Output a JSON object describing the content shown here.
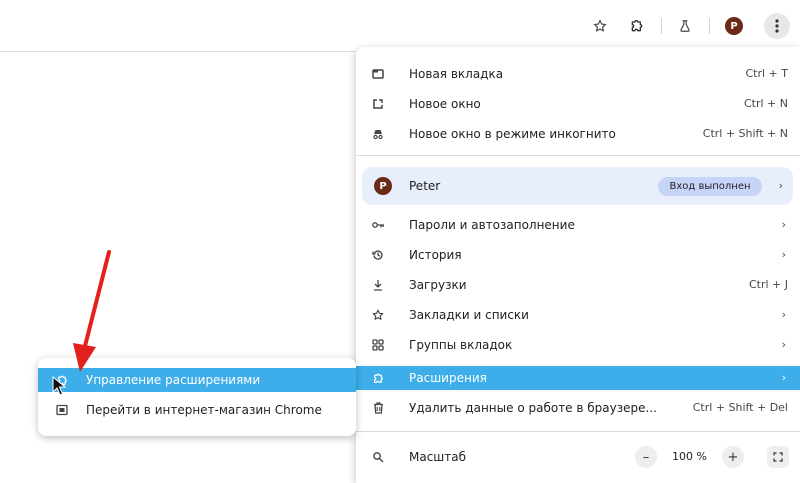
{
  "toolbar": {
    "icons": [
      "star-icon",
      "extensions-puzzle-icon",
      "labs-flask-icon",
      "profile-avatar",
      "kebab-menu-icon"
    ],
    "avatar_letter": "P"
  },
  "main_menu": {
    "new_tab": {
      "label": "Новая вкладка",
      "shortcut": "Ctrl + T"
    },
    "new_window": {
      "label": "Новое окно",
      "shortcut": "Ctrl + N"
    },
    "incognito": {
      "label": "Новое окно в режиме инкогнито",
      "shortcut": "Ctrl + Shift + N"
    },
    "profile": {
      "avatar": "P",
      "name": "Peter",
      "status": "Вход выполнен",
      "arrow": "›"
    },
    "passwords": {
      "label": "Пароли и автозаполнение",
      "arrow": "›"
    },
    "history": {
      "label": "История",
      "arrow": "›"
    },
    "downloads": {
      "label": "Загрузки",
      "shortcut": "Ctrl + J"
    },
    "bookmarks": {
      "label": "Закладки и списки",
      "arrow": "›"
    },
    "tab_groups": {
      "label": "Группы вкладок",
      "arrow": "›"
    },
    "extensions": {
      "label": "Расширения",
      "arrow": "›",
      "highlight_color": "#3daee9"
    },
    "clear_data": {
      "label": "Удалить данные о работе в браузере...",
      "shortcut": "Ctrl + Shift + Del"
    },
    "zoom": {
      "label": "Масштаб",
      "minus": "–",
      "value": "100 %",
      "plus": "+",
      "fullscreen": "⛶"
    }
  },
  "submenu": {
    "manage_extensions": {
      "label": "Управление расширениями"
    },
    "web_store": {
      "label": "Перейти в интернет-магазин Chrome"
    }
  },
  "annotation": {
    "arrow_color": "#e3211c"
  }
}
